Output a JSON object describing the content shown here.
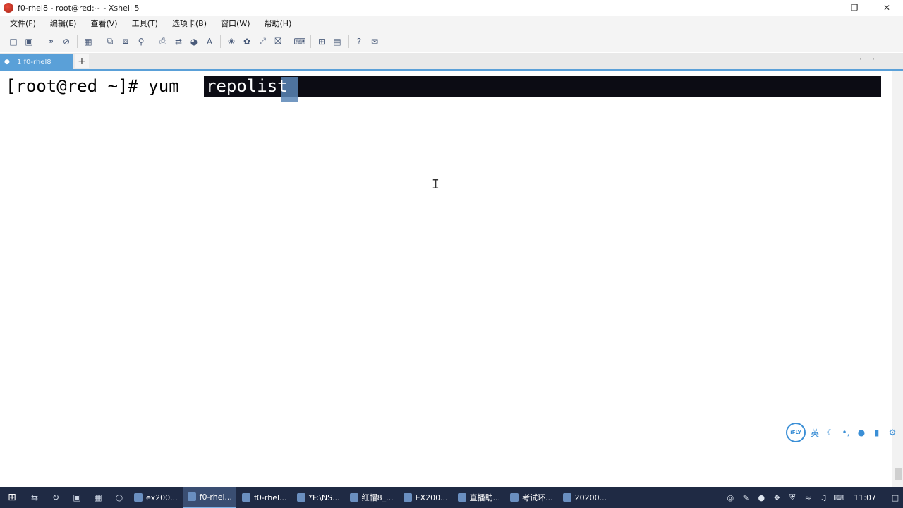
{
  "window": {
    "title": "f0-rhel8 - root@red:~ - Xshell 5"
  },
  "menu": [
    "文件(F)",
    "编辑(E)",
    "查看(V)",
    "工具(T)",
    "选项卡(B)",
    "窗口(W)",
    "帮助(H)"
  ],
  "tab": {
    "label": "1 f0-rhel8",
    "add": "+",
    "nav": "‹ ›"
  },
  "terminal": {
    "prompt": "[root@red ~]# yum  ",
    "selected": "repolist",
    "ibeam": "I"
  },
  "ime": {
    "logo": "iFLY",
    "lang": "英"
  },
  "taskbar": {
    "apps": [
      "ex200...",
      "f0-rhel...",
      "f0-rhel...",
      "*F:\\NS...",
      "红帽8_...",
      "EX200...",
      "直播助...",
      "考试环...",
      "20200..."
    ],
    "time": "11:07"
  },
  "colors": {
    "accent": "#5aa0d8",
    "taskbar": "#1f2a44",
    "selection": "#0c0c14"
  }
}
